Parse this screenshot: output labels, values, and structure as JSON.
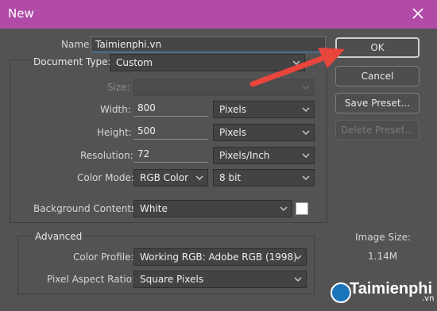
{
  "window": {
    "title": "New"
  },
  "form": {
    "name_label": "Name:",
    "name_value": "Taimienphi.vn",
    "doc_type_label": "Document Type:",
    "doc_type_value": "Custom",
    "size_label": "Size:",
    "width_label": "Width:",
    "width_value": "800",
    "width_unit": "Pixels",
    "height_label": "Height:",
    "height_value": "500",
    "height_unit": "Pixels",
    "resolution_label": "Resolution:",
    "resolution_value": "72",
    "resolution_unit": "Pixels/Inch",
    "color_mode_label": "Color Mode:",
    "color_mode_value": "RGB Color",
    "bit_depth_value": "8 bit",
    "bg_contents_label": "Background Contents:",
    "bg_contents_value": "White",
    "bg_swatch_color": "#ffffff"
  },
  "advanced": {
    "title": "Advanced",
    "color_profile_label": "Color Profile:",
    "color_profile_value": "Working RGB:  Adobe RGB (1998)",
    "pixel_aspect_label": "Pixel Aspect Ratio:",
    "pixel_aspect_value": "Square Pixels"
  },
  "buttons": {
    "ok": "OK",
    "cancel": "Cancel",
    "save_preset": "Save Preset...",
    "delete_preset": "Delete Preset..."
  },
  "info": {
    "image_size_label": "Image Size:",
    "image_size_value": "1.14M"
  },
  "watermark": {
    "brand": "Taimienphi",
    "suffix": ".vn"
  },
  "colors": {
    "titlebar": "#b24ba8",
    "arrow": "#e8453c",
    "dialog_bg": "#535353"
  }
}
